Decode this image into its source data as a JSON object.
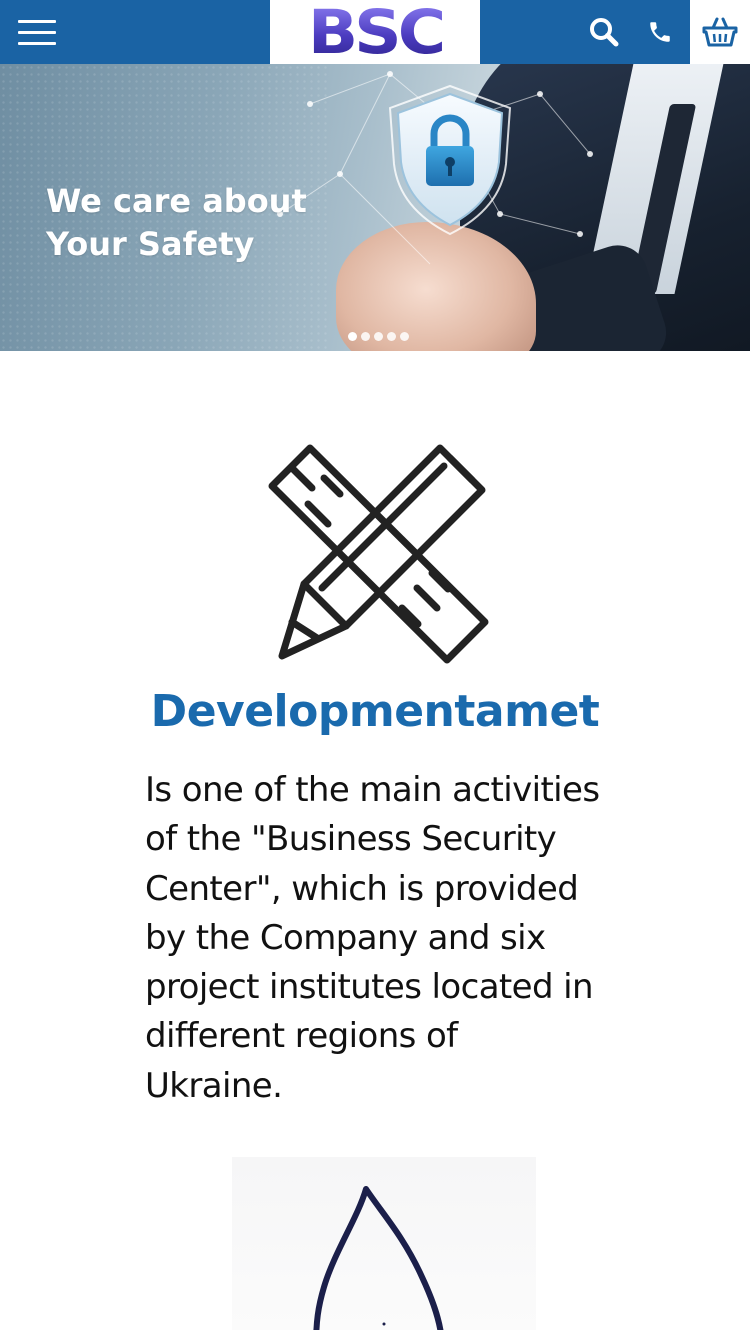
{
  "header": {
    "logo_text": "BSC",
    "icons": {
      "menu": "hamburger-menu-icon",
      "search": "search-icon",
      "phone": "phone-icon",
      "cart": "shopping-basket-icon"
    },
    "colors": {
      "bar": "#1a63a4",
      "logo": "#4b3bbf"
    }
  },
  "hero": {
    "line1": "We care about",
    "line2": "Your Safety",
    "slide_count": 5,
    "active_slide": 1
  },
  "service": {
    "icon": "pencil-ruler-icon",
    "title": "Developmentamet",
    "description_lines": [
      "Is one of the main activities",
      "of the \"Business Security",
      "Center\", which is provided",
      "by the Company and six",
      "project institutes located in",
      "different regions of",
      "Ukraine."
    ],
    "title_color": "#1a6aad"
  },
  "next_service": {
    "icon": "flame-icon"
  }
}
